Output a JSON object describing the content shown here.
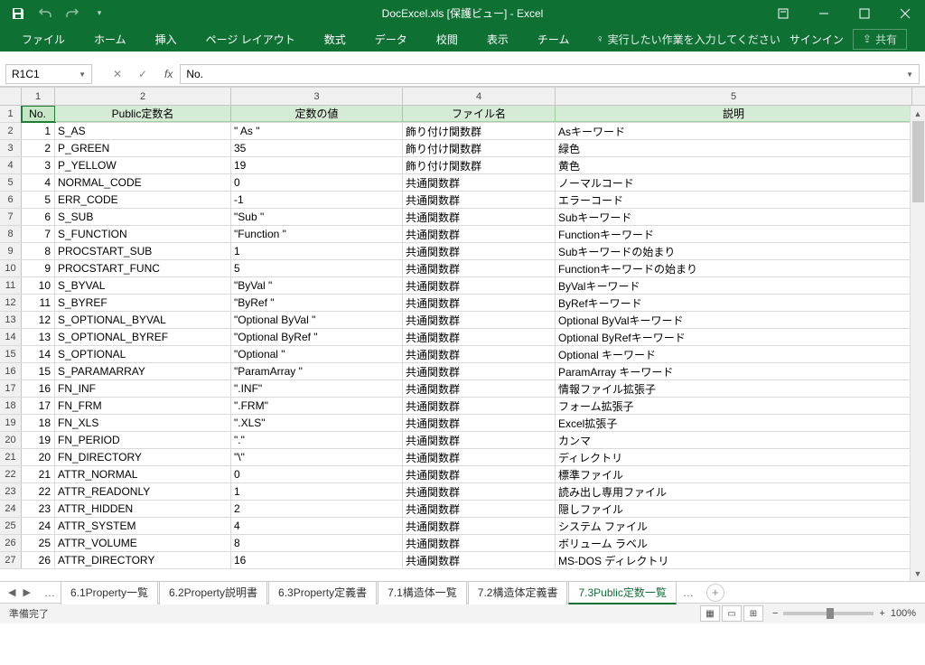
{
  "title": "DocExcel.xls [保護ビュー] - Excel",
  "qat": {
    "save": "save-icon",
    "undo": "undo-icon",
    "redo": "redo-icon"
  },
  "ribbon": {
    "tabs": [
      "ファイル",
      "ホーム",
      "挿入",
      "ページ レイアウト",
      "数式",
      "データ",
      "校閲",
      "表示",
      "チーム"
    ],
    "tellme": "実行したい作業を入力してください",
    "signin": "サインイン",
    "share": "共有"
  },
  "namebox": "R1C1",
  "formula": "No.",
  "columns": [
    "1",
    "2",
    "3",
    "4",
    "5"
  ],
  "headers": [
    "No.",
    "Public定数名",
    "定数の値",
    "ファイル名",
    "説明"
  ],
  "rows": [
    {
      "n": "1",
      "a": "S_AS",
      "b": "\" As \"",
      "c": "飾り付け関数群",
      "d": "Asキーワード"
    },
    {
      "n": "2",
      "a": "P_GREEN",
      "b": "35",
      "c": "飾り付け関数群",
      "d": "緑色"
    },
    {
      "n": "3",
      "a": "P_YELLOW",
      "b": "19",
      "c": "飾り付け関数群",
      "d": "黄色"
    },
    {
      "n": "4",
      "a": "NORMAL_CODE",
      "b": "0",
      "c": "共通関数群",
      "d": "ノーマルコード"
    },
    {
      "n": "5",
      "a": "ERR_CODE",
      "b": "   -1",
      "c": "共通関数群",
      "d": "エラーコード"
    },
    {
      "n": "6",
      "a": "S_SUB",
      "b": "\"Sub \"",
      "c": "共通関数群",
      "d": "Subキーワード"
    },
    {
      "n": "7",
      "a": "S_FUNCTION",
      "b": "\"Function \"",
      "c": "共通関数群",
      "d": "Functionキーワード"
    },
    {
      "n": "8",
      "a": "PROCSTART_SUB",
      "b": "1",
      "c": "共通関数群",
      "d": "Subキーワードの始まり"
    },
    {
      "n": "9",
      "a": "PROCSTART_FUNC",
      "b": "5",
      "c": "共通関数群",
      "d": "Functionキーワードの始まり"
    },
    {
      "n": "10",
      "a": "S_BYVAL",
      "b": "\"ByVal \"",
      "c": "共通関数群",
      "d": "ByValキーワード"
    },
    {
      "n": "11",
      "a": "S_BYREF",
      "b": "\"ByRef \"",
      "c": "共通関数群",
      "d": "ByRefキーワード"
    },
    {
      "n": "12",
      "a": "S_OPTIONAL_BYVAL",
      "b": "\"Optional ByVal \"",
      "c": "共通関数群",
      "d": "Optional ByValキーワード"
    },
    {
      "n": "13",
      "a": "S_OPTIONAL_BYREF",
      "b": "\"Optional ByRef \"",
      "c": "共通関数群",
      "d": "Optional ByRefキーワード"
    },
    {
      "n": "14",
      "a": "S_OPTIONAL",
      "b": "\"Optional \"",
      "c": "共通関数群",
      "d": "Optional キーワード"
    },
    {
      "n": "15",
      "a": "S_PARAMARRAY",
      "b": "\"ParamArray \"",
      "c": "共通関数群",
      "d": "ParamArray キーワード"
    },
    {
      "n": "16",
      "a": "FN_INF",
      "b": "\".INF\"",
      "c": "共通関数群",
      "d": "情報ファイル拡張子"
    },
    {
      "n": "17",
      "a": "FN_FRM",
      "b": "\".FRM\"",
      "c": "共通関数群",
      "d": "フォーム拡張子"
    },
    {
      "n": "18",
      "a": "FN_XLS",
      "b": "\".XLS\"",
      "c": "共通関数群",
      "d": "Excel拡張子"
    },
    {
      "n": "19",
      "a": "FN_PERIOD",
      "b": "\".\"",
      "c": "共通関数群",
      "d": "カンマ"
    },
    {
      "n": "20",
      "a": "FN_DIRECTORY",
      "b": "\"\\\"",
      "c": "共通関数群",
      "d": "ディレクトリ"
    },
    {
      "n": "21",
      "a": "ATTR_NORMAL",
      "b": "0",
      "c": "共通関数群",
      "d": "標準ファイル"
    },
    {
      "n": "22",
      "a": "ATTR_READONLY",
      "b": "1",
      "c": "共通関数群",
      "d": "読み出し専用ファイル"
    },
    {
      "n": "23",
      "a": "ATTR_HIDDEN",
      "b": "2",
      "c": "共通関数群",
      "d": "隠しファイル"
    },
    {
      "n": "24",
      "a": "ATTR_SYSTEM",
      "b": "4",
      "c": "共通関数群",
      "d": "システム ファイル"
    },
    {
      "n": "25",
      "a": "ATTR_VOLUME",
      "b": "8",
      "c": "共通関数群",
      "d": "ボリューム ラベル"
    },
    {
      "n": "26",
      "a": "ATTR_DIRECTORY",
      "b": "16",
      "c": "共通関数群",
      "d": "MS-DOS ディレクトリ"
    }
  ],
  "sheets": [
    "6.1Property一覧",
    "6.2Property説明書",
    "6.3Property定義書",
    "7.1構造体一覧",
    "7.2構造体定義書",
    "7.3Public定数一覧"
  ],
  "active_sheet": 5,
  "status": {
    "ready": "準備完了",
    "zoom": "100%"
  }
}
